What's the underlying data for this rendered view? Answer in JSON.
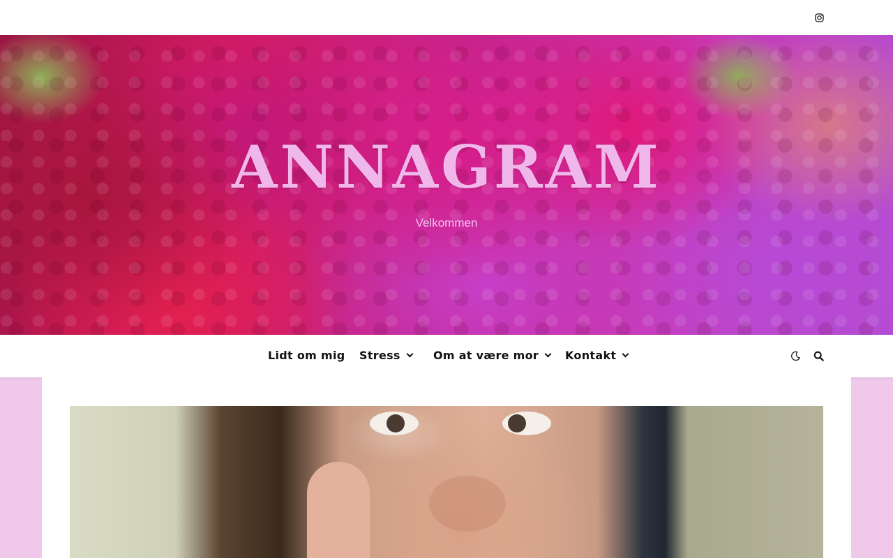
{
  "site": {
    "title": "ANNAGRAM",
    "tagline": "Velkommen"
  },
  "topbar": {
    "icons": [
      "instagram-icon"
    ]
  },
  "nav": {
    "items": [
      {
        "label": "Lidt om mig",
        "has_dropdown": false
      },
      {
        "label": "Stress",
        "has_dropdown": true
      },
      {
        "label": "Om at være mor",
        "has_dropdown": true
      },
      {
        "label": "Kontakt",
        "has_dropdown": true
      }
    ],
    "right_icons": [
      "moon-icon",
      "search-icon"
    ]
  },
  "colors": {
    "page_background": "#f0c8ea",
    "title_color": "#f0b8ea",
    "nav_text": "#111111"
  },
  "content": {
    "featured_image": "portrait-photo"
  }
}
